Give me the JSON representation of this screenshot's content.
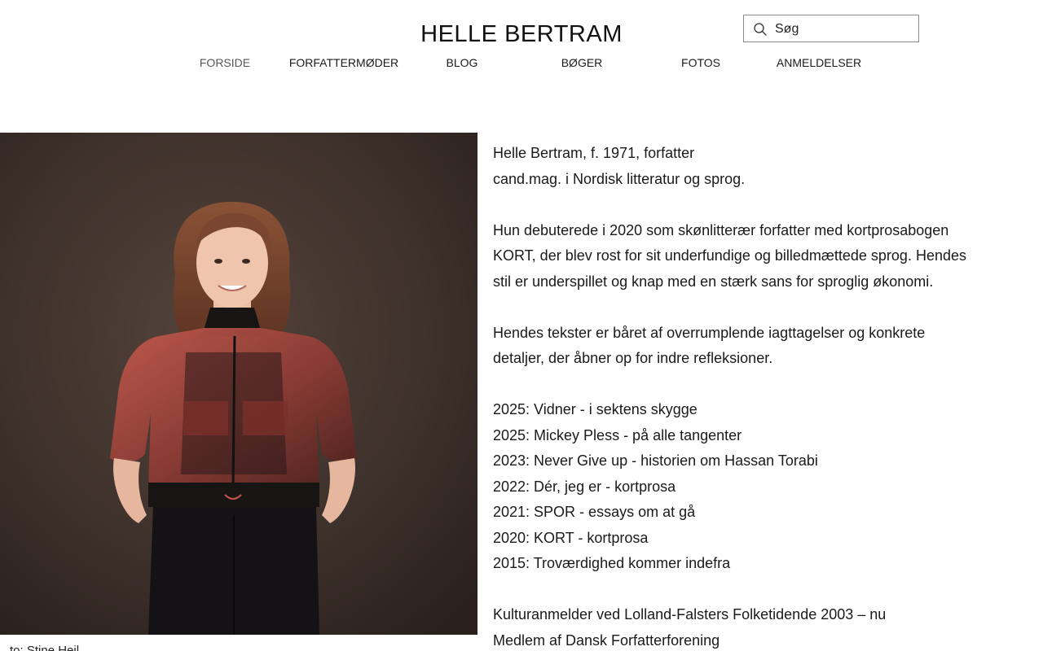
{
  "site": {
    "title": "HELLE BERTRAM"
  },
  "search": {
    "placeholder": "Søg"
  },
  "nav": {
    "items": [
      {
        "label": "FORSIDE"
      },
      {
        "label": "FORFATTERMØDER"
      },
      {
        "label": "BLOG"
      },
      {
        "label": "BØGER"
      },
      {
        "label": "FOTOS"
      },
      {
        "label": "ANMELDELSER"
      }
    ],
    "active": "FORSIDE"
  },
  "photo": {
    "caption": "to: Stine Heil..."
  },
  "bio": {
    "intro": [
      "Helle Bertram, f. 1971, forfatter",
      "cand.mag. i Nordisk litteratur og sprog."
    ],
    "debut": [
      "Hun debuterede i 2020 som skønlitterær forfatter med kortprosabogen",
      "KORT, der blev rost for sit underfundige og billedmættede sprog. Hendes",
      "stil er underspillet og knap med en stærk sans for sproglig økonomi."
    ],
    "style": [
      "Hendes tekster er båret af overrumplende iagttagelser og konkrete",
      "detaljer, der åbner op for indre refleksioner."
    ],
    "books": [
      "2025: Vidner - i sektens skygge",
      "2025: Mickey Pless - på alle tangenter",
      "2023: Never Give up - historien om Hassan Torabi",
      "2022: Dér, jeg er - kortprosa",
      "2021: SPOR - essays om at gå",
      "2020: KORT - kortprosa",
      "2015: Troværdighed kommer indefra"
    ],
    "roles": [
      "Kulturanmelder ved  Lolland-Falsters Folketidende 2003 – nu",
      "Medlem af Dansk Forfatterforening"
    ]
  },
  "colors": {
    "background": "#ffffff",
    "text": "#1a1a1a",
    "photo_wall": "#3b2f2a",
    "jacket": "#a8483f"
  }
}
